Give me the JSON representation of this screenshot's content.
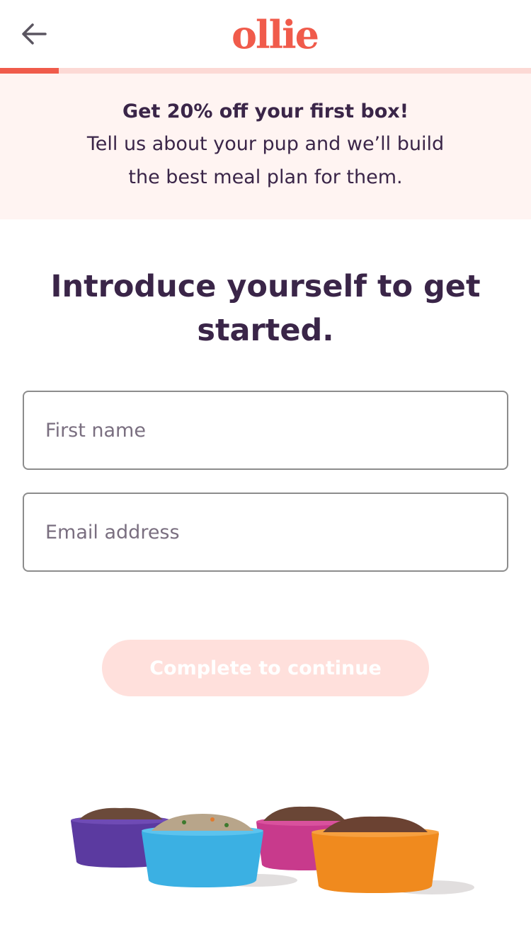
{
  "header": {
    "logo_text": "ollie",
    "back_icon": "arrow-left-icon"
  },
  "progress": {
    "fraction": 0.11
  },
  "promo": {
    "title": "Get 20% off your first box!",
    "text": "Tell us about your pup and we’ll build the best meal plan for them."
  },
  "main": {
    "heading": "Introduce yourself to get started."
  },
  "form": {
    "first_name_placeholder": "First name",
    "email_placeholder": "Email address",
    "first_name_value": "",
    "email_value": ""
  },
  "cta": {
    "label": "Complete to continue"
  },
  "colors": {
    "brand": "#f05b4b",
    "text": "#3a2548",
    "promo_bg": "#fff4f2",
    "progress_track": "#fcd9d5",
    "cta_disabled": "#ffe0dc",
    "bowl_purple": "#5b3aa0",
    "bowl_blue": "#3bb0e3",
    "bowl_pink": "#c83a8c",
    "bowl_orange": "#f08a1e"
  }
}
